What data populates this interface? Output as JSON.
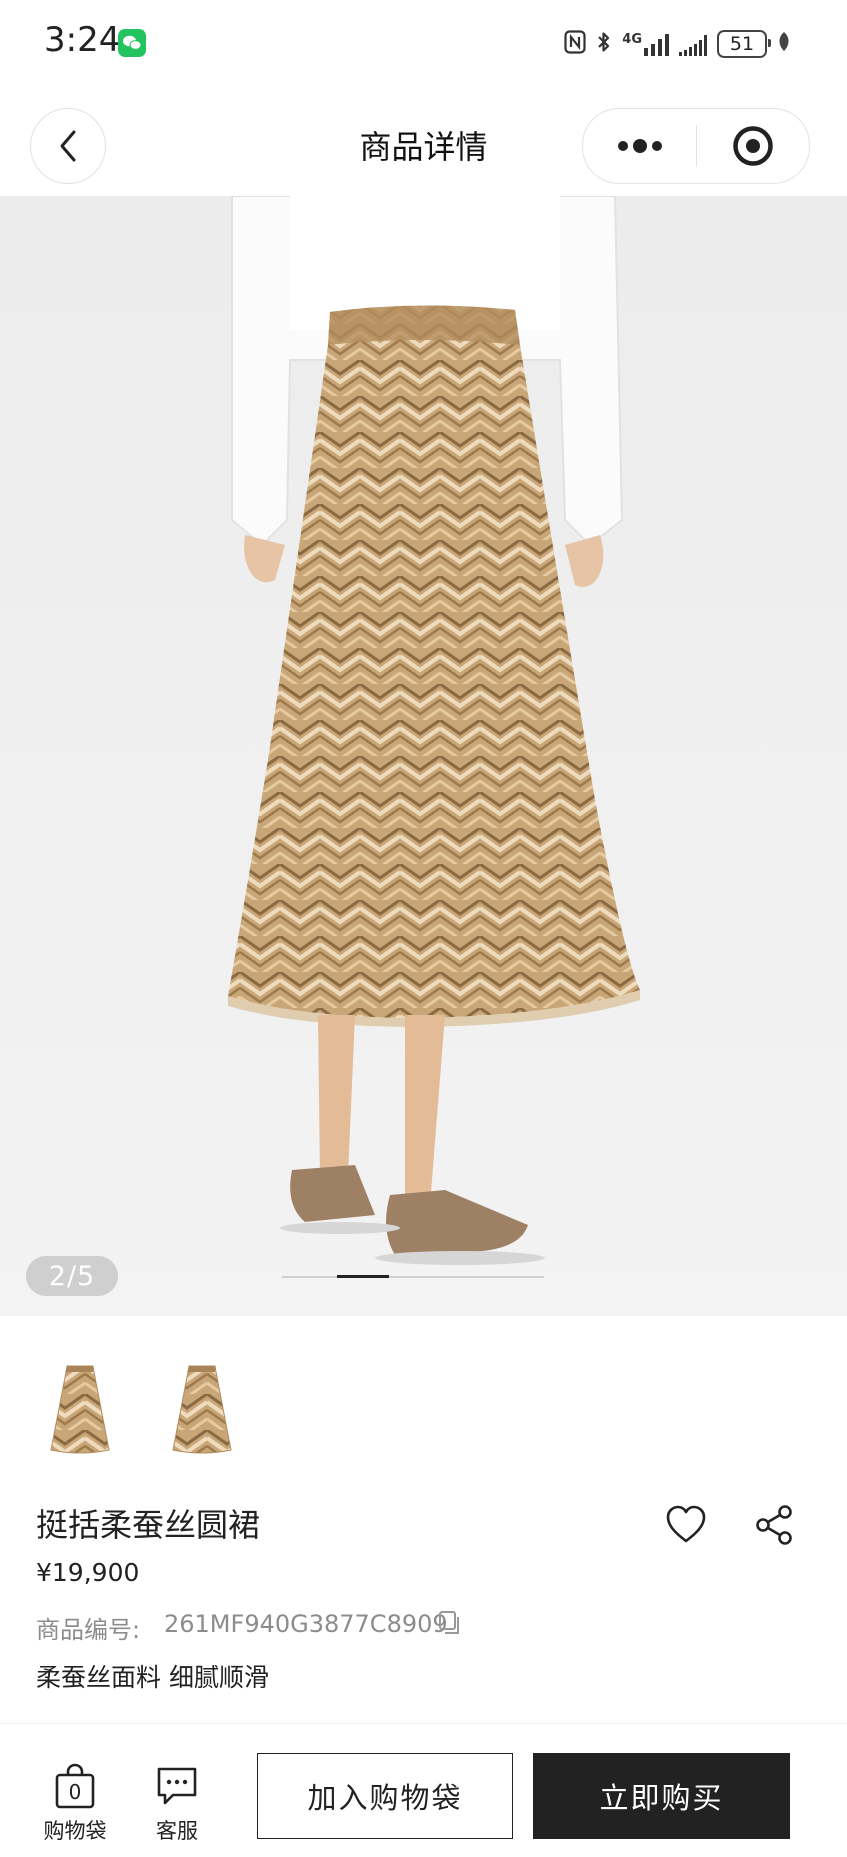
{
  "status_bar": {
    "time": "3:24",
    "network": "4G",
    "battery": "51"
  },
  "nav": {
    "title": "商品详情"
  },
  "gallery": {
    "page_indicator": "2/5",
    "current_index": 2,
    "total": 5
  },
  "product": {
    "name": "挺括柔蚕丝圆裙",
    "price": "¥19,900",
    "sku_label": "商品编号:",
    "sku": "261MF940G3877C8909",
    "tagline": "柔蚕丝面料 细腻顺滑"
  },
  "bottom_bar": {
    "bag_label": "购物袋",
    "bag_count": "0",
    "service_label": "客服",
    "add_to_cart": "加入购物袋",
    "buy_now": "立即购买"
  },
  "colors": {
    "accent": "#222222",
    "wechat_green": "#23c45f",
    "muted_text": "#8c8c8c"
  },
  "icons": [
    "wechat-icon",
    "nfc-icon",
    "bluetooth-icon",
    "signal-icon",
    "battery-icon",
    "back-icon",
    "more-icon",
    "mini-program-close-icon",
    "heart-icon",
    "share-icon",
    "copy-icon",
    "shopping-bag-icon",
    "chat-icon"
  ]
}
